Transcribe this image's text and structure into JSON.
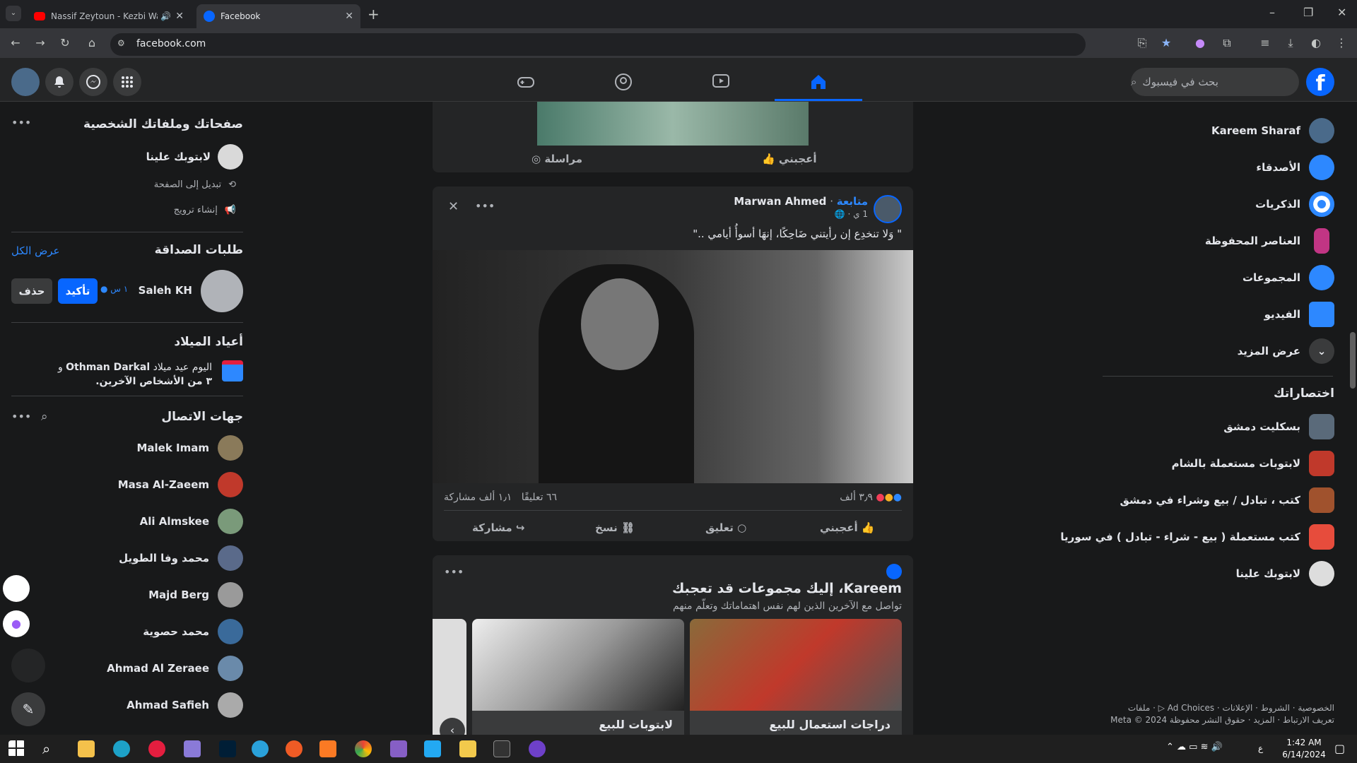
{
  "browser": {
    "tabs": [
      {
        "title": "Nassif Zeytoun - Kezbi Wara"
      },
      {
        "title": "Facebook"
      }
    ],
    "url": "facebook.com"
  },
  "header": {
    "search_placeholder": "بحث في فيسبوك"
  },
  "left": {
    "pages": {
      "title": "صفحاتك وملفاتك الشخصية",
      "page_name": "لابتوبك علينا",
      "switch": "تبديل إلى الصفحة",
      "promote": "إنشاء ترويج"
    },
    "friend_requests": {
      "title": "طلبات الصداقة",
      "see_all": "عرض الكل",
      "name": "Saleh KH",
      "time": "١ س",
      "confirm": "تأكيد",
      "delete": "حذف"
    },
    "birthdays": {
      "title": "أعياد الميلاد",
      "line1_prefix": "اليوم عيد ميلاد",
      "line1_name": "Othman Darkal",
      "line1_suffix": "و",
      "line2": "٣ من الأشخاص الآخرين."
    },
    "contacts": {
      "title": "جهات الاتصال",
      "items": [
        "Malek Imam",
        "Masa Al-Zaeem",
        "Ali Almskee",
        "محمد وفا الطويل",
        "Majd Berg",
        "محمد حصوية",
        "Ahmad Al Zeraee",
        "Ahmad Safieh"
      ]
    }
  },
  "feed": {
    "top_card": {
      "like": "أعجبني",
      "message": "مراسلة"
    },
    "post": {
      "author": "Marwan Ahmed",
      "follow": "متابعة",
      "time": "1 ي",
      "text": "\" وَلا تنخدِع إن رأيتني ضَاحِكًا، إنهَا أسوأُ أيامي ..\"",
      "reactions": "٣٫٩ ألف",
      "comments": "٦٦ تعليقًا",
      "shares": "١٫١ ألف مشاركة",
      "like": "أعجبني",
      "comment": "تعليق",
      "copy": "نسخ",
      "share": "مشاركة"
    },
    "groups": {
      "title": "Kareem، إليك مجموعات قد تعجبك",
      "subtitle": "تواصل مع الآخرين الذين لهم نفس اهتماماتك وتعلّم منهم",
      "items": [
        "دراجات استعمال للبيع",
        "لابتوبات للبيع"
      ]
    }
  },
  "right": {
    "profile": "Kareem Sharaf",
    "menu": [
      "الأصدقاء",
      "الذكريات",
      "العناصر المحفوظة",
      "المجموعات",
      "الفيديو",
      "عرض المزيد"
    ],
    "shortcuts_title": "اختصاراتك",
    "shortcuts": [
      "بسكليت دمشق",
      "لابتوبات مستعملة بالشام",
      "كتب ، تبادل / بيع وشراء في دمشق",
      "كتب مستعملة ( بيع - شراء - تبادل ) في سوريا",
      "لابتوبك علينا"
    ],
    "footer1": "الخصوصية · الشروط · الإعلانات · Ad Choices ▷ · ملفات",
    "footer2": "تعريف الارتباط · المزيد · حقوق النشر محفوظة Meta © 2024"
  },
  "taskbar": {
    "time": "1:42 AM",
    "date": "6/14/2024",
    "lang": "ع"
  },
  "colors": {
    "accent": "#0866ff",
    "link": "#2d88ff",
    "bg": "#18191a",
    "card": "#242526"
  }
}
